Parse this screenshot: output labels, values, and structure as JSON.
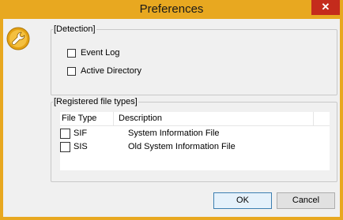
{
  "window": {
    "title": "Preferences",
    "close_glyph": "✕"
  },
  "app_icon": {
    "name": "wrench-icon",
    "color": "#e8a820"
  },
  "detection": {
    "legend": "[Detection]",
    "options": [
      {
        "label": "Event Log",
        "checked": false
      },
      {
        "label": "Active Directory",
        "checked": false
      }
    ]
  },
  "registered": {
    "legend": "[Registered file types]",
    "columns": [
      "File Type",
      "Description"
    ],
    "rows": [
      {
        "type": "SIF",
        "description": "System Information File",
        "checked": false
      },
      {
        "type": "SIS",
        "description": "Old System Information File",
        "checked": false
      }
    ]
  },
  "buttons": {
    "ok": "OK",
    "cancel": "Cancel"
  }
}
